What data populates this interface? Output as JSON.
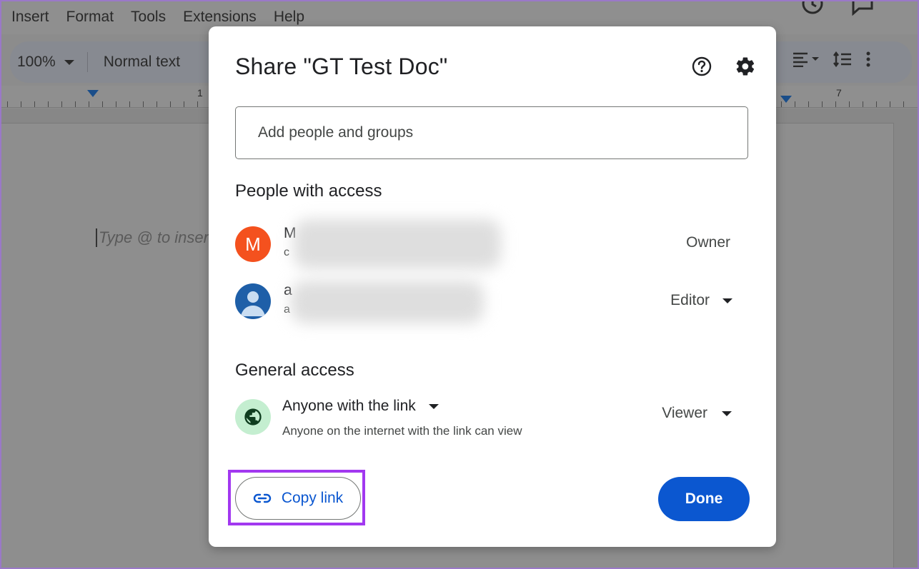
{
  "colors": {
    "accent": "#0b57d0",
    "owner_avatar": "#f4511e",
    "editor_avatar": "#1e5fa8",
    "globe_bg": "#c4eed0",
    "highlight": "#a238f0"
  },
  "menubar": {
    "items": [
      "Insert",
      "Format",
      "Tools",
      "Extensions",
      "Help"
    ]
  },
  "toolbar": {
    "zoom": "100%",
    "paragraph_style": "Normal text"
  },
  "ruler": {
    "labels": [
      "1",
      "7"
    ]
  },
  "document": {
    "placeholder": "Type @ to inser"
  },
  "dialog": {
    "title": "Share \"GT Test Doc\"",
    "help_icon": "help-circle-icon",
    "settings_icon": "gear-icon",
    "add_people_placeholder": "Add people and groups",
    "people_section_title": "People with access",
    "people": [
      {
        "avatar_letter": "M",
        "name": "M",
        "email": "c",
        "role": "Owner"
      },
      {
        "avatar_icon": "person-icon",
        "name": "a",
        "email": "a",
        "role": "Editor"
      }
    ],
    "general_access_title": "General access",
    "general_access": {
      "icon": "globe-icon",
      "setting": "Anyone with the link",
      "description": "Anyone on the internet with the link can view",
      "role": "Viewer"
    },
    "copy_link_label": "Copy link",
    "copy_link_icon": "link-icon",
    "done_label": "Done"
  }
}
